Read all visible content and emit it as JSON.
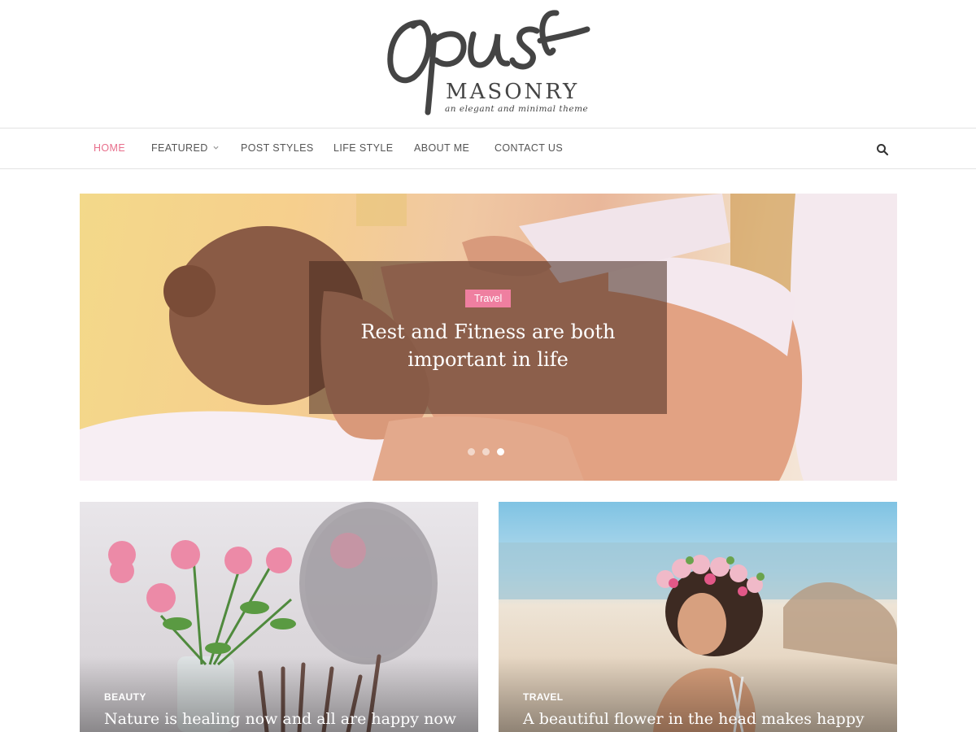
{
  "logo": {
    "script_text": "Opus",
    "word": "MASONRY",
    "tagline": "an elegant and minimal theme"
  },
  "nav": {
    "items": [
      {
        "label": "HOME",
        "active": true
      },
      {
        "label": "FEATURED",
        "has_dropdown": true
      },
      {
        "label": "POST STYLES"
      },
      {
        "label": "LIFE STYLE"
      },
      {
        "label": "ABOUT ME"
      },
      {
        "label": "CONTACT US"
      }
    ],
    "search_icon": "search-icon",
    "dropdown_icon": "chevron-down-icon"
  },
  "slider": {
    "category": "Travel",
    "title_line1": "Rest and Fitness are both",
    "title_line2": "important in life",
    "slide_count": 3,
    "active_slide": 3
  },
  "posts": [
    {
      "category": "BEAUTY",
      "title": "Nature is healing now and all are happy now"
    },
    {
      "category": "TRAVEL",
      "title": "A beautiful flower in the head makes happy"
    }
  ],
  "colors": {
    "accent": "#e86f8c",
    "badge": "#ef7fa0",
    "nav_text": "#555555",
    "border": "#e3e3e3"
  }
}
